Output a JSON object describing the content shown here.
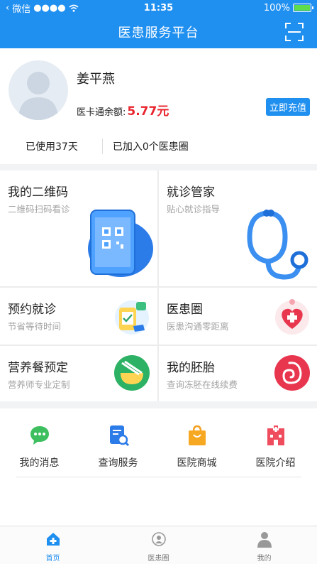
{
  "status_bar": {
    "carrier": "微信",
    "signal": "●●●●",
    "time": "11:35",
    "battery": "100%"
  },
  "header": {
    "title": "医患服务平台"
  },
  "profile": {
    "name": "姜平燕",
    "balance_label": "医卡通余额:",
    "balance_value": "5.77元",
    "recharge_label": "立即充值",
    "days_used": "已使用37天",
    "circles_joined": "已加入0个医患圈"
  },
  "tiles": [
    {
      "title": "我的二维码",
      "subtitle": "二维码扫码看诊"
    },
    {
      "title": "就诊管家",
      "subtitle": "贴心就诊指导"
    },
    {
      "title": "预约就诊",
      "subtitle": "节省等待时间"
    },
    {
      "title": "医患圈",
      "subtitle": "医患沟通零距离"
    },
    {
      "title": "营养餐预定",
      "subtitle": "营养师专业定制"
    },
    {
      "title": "我的胚胎",
      "subtitle": "查询冻胚在线续费"
    }
  ],
  "services": [
    {
      "label": "我的消息",
      "icon": "message-icon"
    },
    {
      "label": "查询服务",
      "icon": "search-document-icon"
    },
    {
      "label": "医院商城",
      "icon": "shopping-bag-icon"
    },
    {
      "label": "医院介绍",
      "icon": "hospital-icon"
    }
  ],
  "tabbar": [
    {
      "label": "首页",
      "icon": "home-plus-icon",
      "active": true
    },
    {
      "label": "医患圈",
      "icon": "circle-people-icon",
      "active": false
    },
    {
      "label": "我的",
      "icon": "person-icon",
      "active": false
    }
  ],
  "colors": {
    "primary": "#1f8ff0",
    "balance": "#e8242d",
    "subtitle": "#a3a3a3"
  }
}
